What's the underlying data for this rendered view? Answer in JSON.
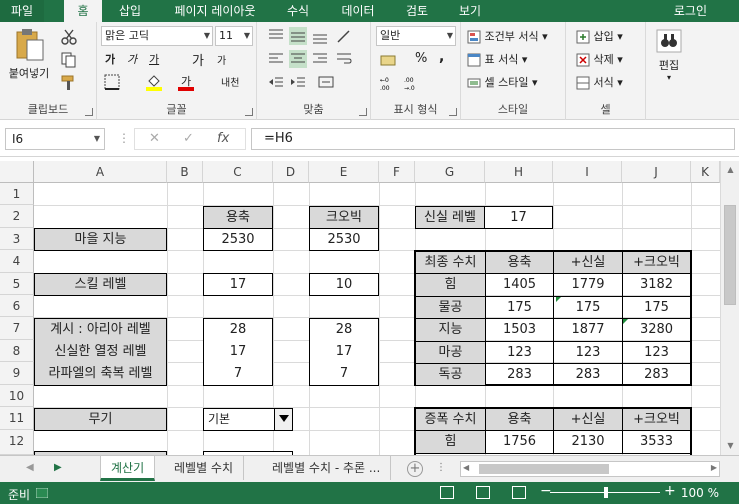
{
  "ribbon_tabs": [
    "파일",
    "홈",
    "삽입",
    "페이지 레이아웃",
    "수식",
    "데이터",
    "검토",
    "보기"
  ],
  "login_label": "로그인",
  "clipboard": {
    "paste_label": "붙여넣기",
    "group_label": "클립보드"
  },
  "font": {
    "name": "맑은 고딕",
    "size": "11",
    "group_label": "글꼴",
    "bold": "가",
    "italic": "가",
    "underline": "가",
    "grow": "가",
    "shrink": "가",
    "phonetic": "내천"
  },
  "alignment": {
    "group_label": "맞춤"
  },
  "number": {
    "format": "일반",
    "percent": "%",
    "comma": ",",
    "group_label": "표시 형식"
  },
  "styles": {
    "conditional": "조건부 서식",
    "table": "표 서식",
    "cell": "셀 스타일",
    "group_label": "스타일"
  },
  "cells": {
    "insert": "삽입",
    "delete": "삭제",
    "format": "서식",
    "group_label": "셀"
  },
  "editing": {
    "label": "편집"
  },
  "formula_bar": {
    "name_box": "I6",
    "formula": "=H6",
    "fx": "fx"
  },
  "columns": [
    "A",
    "B",
    "C",
    "D",
    "E",
    "F",
    "G",
    "H",
    "I",
    "J",
    "K"
  ],
  "rows": [
    "1",
    "2",
    "3",
    "4",
    "5",
    "6",
    "7",
    "8",
    "9",
    "10",
    "11",
    "12"
  ],
  "sheet": {
    "c2": "용축",
    "e2": "크오빅",
    "a3": "마을 지능",
    "c3": "2530",
    "e3": "2530",
    "a5": "스킬 레벨",
    "c5": "17",
    "e5": "10",
    "a7": "계시 : 아리아 레벨",
    "a8": "신실한 열정 레벨",
    "a9": "라파엘의 축복 레벨",
    "c7": "28",
    "c8": "17",
    "c9": "7",
    "e7": "28",
    "e8": "17",
    "e9": "7",
    "a11": "무기",
    "c11": "기본",
    "g2": "신실 레벨",
    "h2": "17"
  },
  "final_table": {
    "headers": [
      "최종 수치",
      "용축",
      "+신실",
      "+크오빅"
    ],
    "rows": [
      [
        "힘",
        "1405",
        "1779",
        "3182"
      ],
      [
        "물공",
        "175",
        "175",
        "175"
      ],
      [
        "지능",
        "1503",
        "1877",
        "3280"
      ],
      [
        "마공",
        "123",
        "123",
        "123"
      ],
      [
        "독공",
        "283",
        "283",
        "283"
      ]
    ]
  },
  "increase_table": {
    "headers": [
      "증폭 수치",
      "용축",
      "+신실",
      "+크오빅"
    ],
    "rows": [
      [
        "힘",
        "1756",
        "2130",
        "3533"
      ]
    ]
  },
  "sheet_tabs": [
    "계산기",
    "레벨별 수치",
    "레벨별 수치 - 추론 ..."
  ],
  "status": {
    "ready": "준비",
    "zoom": "100 %"
  },
  "colors": {
    "accent": "#217346",
    "header_fill": "#d9d9d9"
  }
}
